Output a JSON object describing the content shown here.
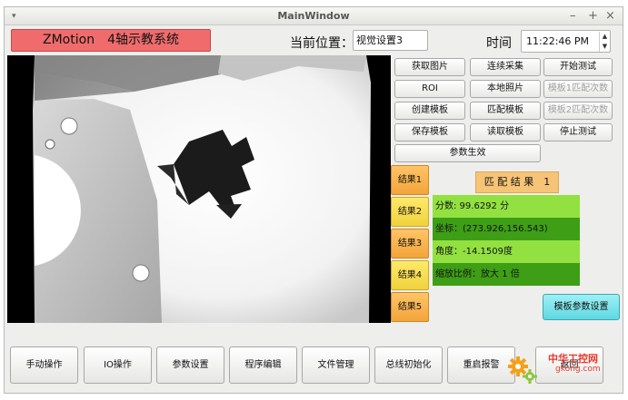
{
  "window": {
    "title": "MainWindow",
    "menu_glyph": "▾",
    "controls": [
      "–",
      "+",
      "×"
    ]
  },
  "banner": {
    "app_name": "ZMotion　4轴示教系统"
  },
  "header": {
    "location_label": "当前位置：",
    "location_value": "视觉设置3",
    "time_label": "时间",
    "time_value": "11:22:46 PM"
  },
  "action_buttons": [
    {
      "label": "获取图片",
      "enabled": true
    },
    {
      "label": "连续采集",
      "enabled": true
    },
    {
      "label": "开始测试",
      "enabled": true
    },
    {
      "label": "ROI",
      "enabled": true
    },
    {
      "label": "本地照片",
      "enabled": true
    },
    {
      "label": "模板1匹配次数",
      "enabled": false
    },
    {
      "label": "创建模板",
      "enabled": true
    },
    {
      "label": "匹配模板",
      "enabled": true
    },
    {
      "label": "模板2匹配次数",
      "enabled": false
    },
    {
      "label": "保存模板",
      "enabled": true
    },
    {
      "label": "读取模板",
      "enabled": true
    },
    {
      "label": "停止测试",
      "enabled": true
    }
  ],
  "apply_button": "参数生效",
  "results": [
    "结果1",
    "结果2",
    "结果3",
    "结果4",
    "结果5"
  ],
  "match": {
    "header": "匹 配 结 果　1",
    "score": "分数: 99.6292 分",
    "coords": "坐标：(273.926,156.543)",
    "angle": "角度：-14.1509度",
    "scale": "缩放比例：放大 1 倍"
  },
  "template_params_button": "模板参数设置",
  "bottom_nav": [
    "手动操作",
    "IO操作",
    "参数设置",
    "程序编辑",
    "文件管理",
    "总线初始化",
    "重启报警",
    "返回"
  ],
  "watermark": {
    "title": "中华工控网",
    "url": "gkong.com"
  },
  "colors": {
    "banner": "#f06c6c",
    "result_orange": "#f3a53a",
    "result_yellow": "#f0d23c",
    "info_light": "#92e141",
    "info_dark": "#3e9e16",
    "template_button": "#5fd8e2"
  }
}
